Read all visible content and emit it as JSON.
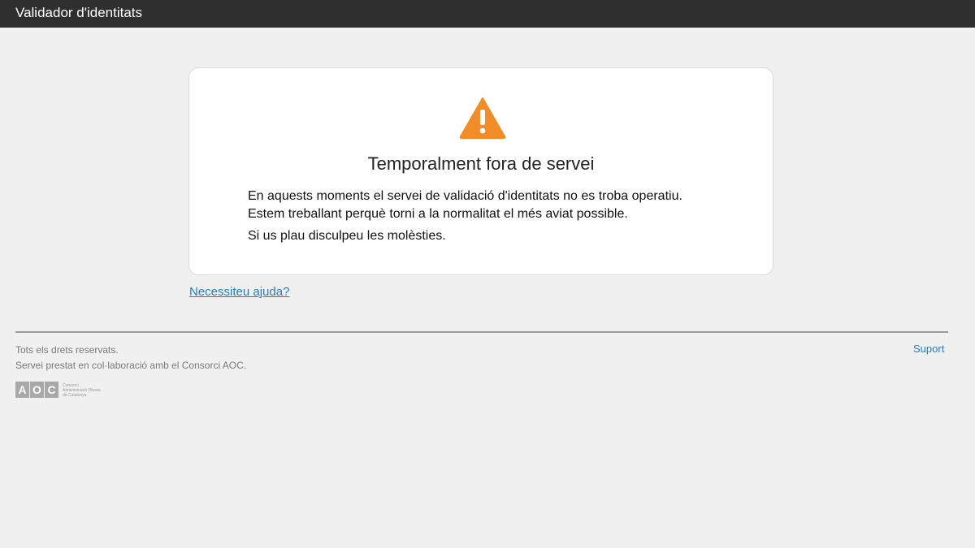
{
  "header": {
    "title": "Validador d'identitats"
  },
  "notice": {
    "icon": "warning-triangle-icon",
    "icon_color": "#f28c28",
    "title": "Temporalment fora de servei",
    "line1": "En aquests moments el servei de validació d'identitats no es troba operatiu.",
    "line2": "Estem treballant perquè torni a la normalitat el més aviat possible.",
    "line3": "Si us plau disculpeu les molèsties."
  },
  "help_link": "Necessiteu ajuda?",
  "footer": {
    "rights": "Tots els drets reservats.",
    "collab": "Servei prestat en col·laboració amb el Consorci AOC.",
    "support_link": "Suport",
    "logo": {
      "letters": "AOC",
      "line1": "Consorci",
      "line2": "Administració Oberta",
      "line3": "de Catalunya"
    }
  },
  "colors": {
    "accent": "#1f7fbf",
    "header_bg": "#2f2f2f",
    "page_bg": "#f0f0f0"
  }
}
